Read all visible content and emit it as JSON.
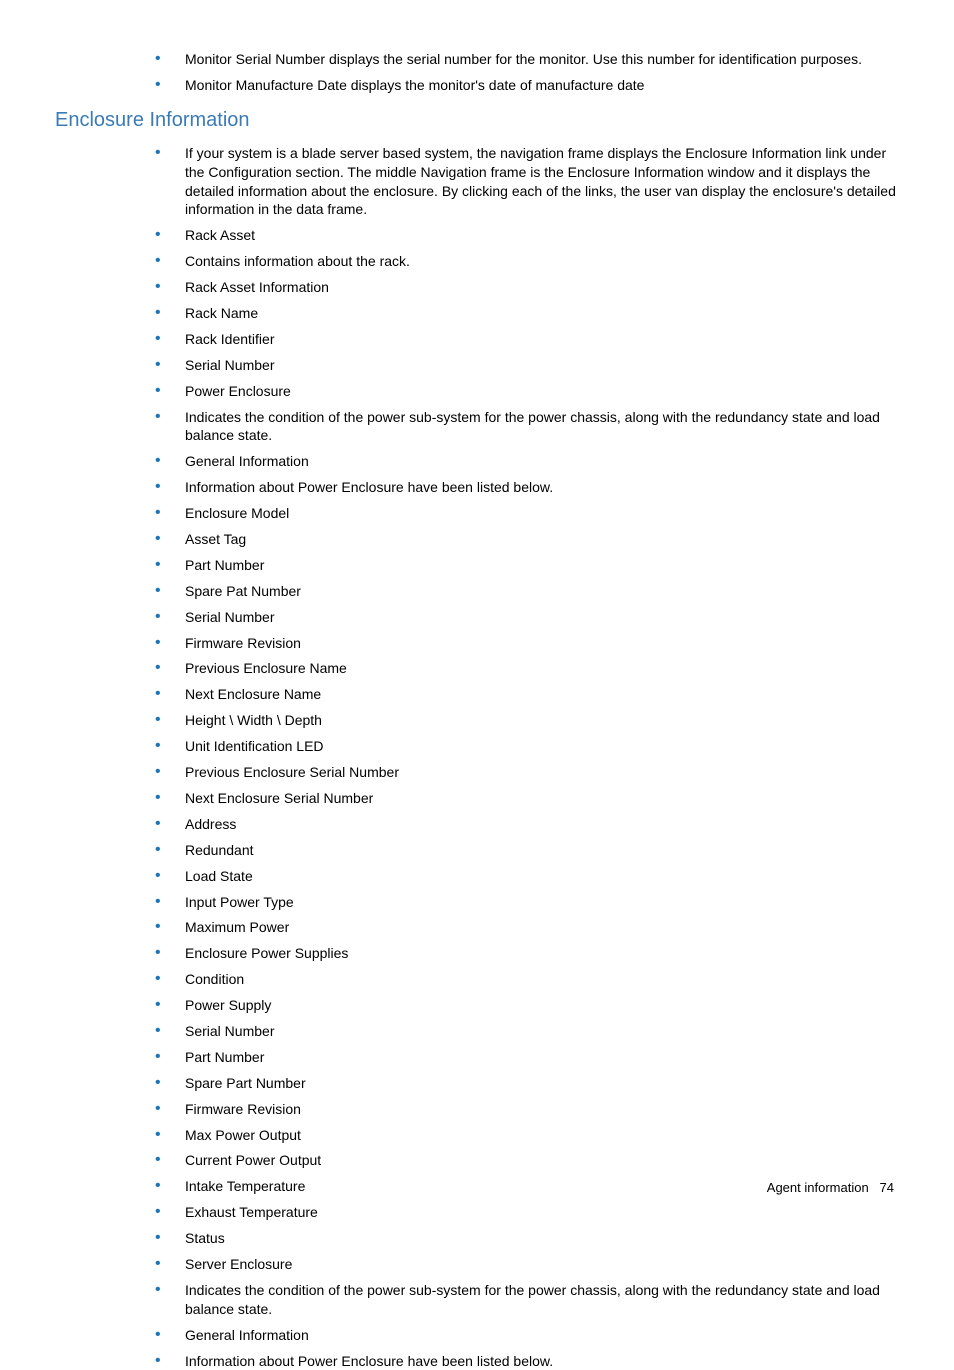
{
  "topList": [
    "Monitor Serial Number displays the serial number for the monitor. Use this number for identification purposes.",
    "Monitor Manufacture Date displays the monitor's date of manufacture date"
  ],
  "heading": "Enclosure Information",
  "mainList": [
    "If your system is a blade server based system, the navigation frame displays the Enclosure Information link under the Configuration section. The middle Navigation frame is the Enclosure Information window and it displays the detailed information about the enclosure. By clicking each of the links, the user van display the enclosure's detailed information in the data frame.",
    "Rack Asset",
    "Contains information about the rack.",
    "Rack Asset Information",
    "Rack Name",
    "Rack Identifier",
    "Serial Number",
    "Power Enclosure",
    "Indicates the condition of the power sub-system for the power chassis, along with the redundancy state and load balance state.",
    "General Information",
    "Information about Power Enclosure have been listed below.",
    "Enclosure Model",
    "Asset Tag",
    "Part Number",
    "Spare Pat Number",
    "Serial Number",
    "Firmware Revision",
    "Previous Enclosure Name",
    "Next Enclosure Name",
    "Height \\ Width \\ Depth",
    "Unit Identification LED",
    "Previous Enclosure Serial Number",
    "Next Enclosure Serial Number",
    "Address",
    "Redundant",
    "Load State",
    "Input Power Type",
    "Maximum Power",
    "Enclosure Power Supplies",
    "Condition",
    "Power Supply",
    "Serial Number",
    "Part Number",
    "Spare Part Number",
    "Firmware Revision",
    "Max Power Output",
    "Current Power Output",
    "Intake Temperature",
    "Exhaust Temperature",
    "Status",
    "Server Enclosure",
    "Indicates the condition of the power sub-system for the power chassis, along with the redundancy state and load balance state.",
    "General Information",
    "Information about Power Enclosure have been listed below."
  ],
  "footer": {
    "section": "Agent information",
    "page": "74"
  }
}
